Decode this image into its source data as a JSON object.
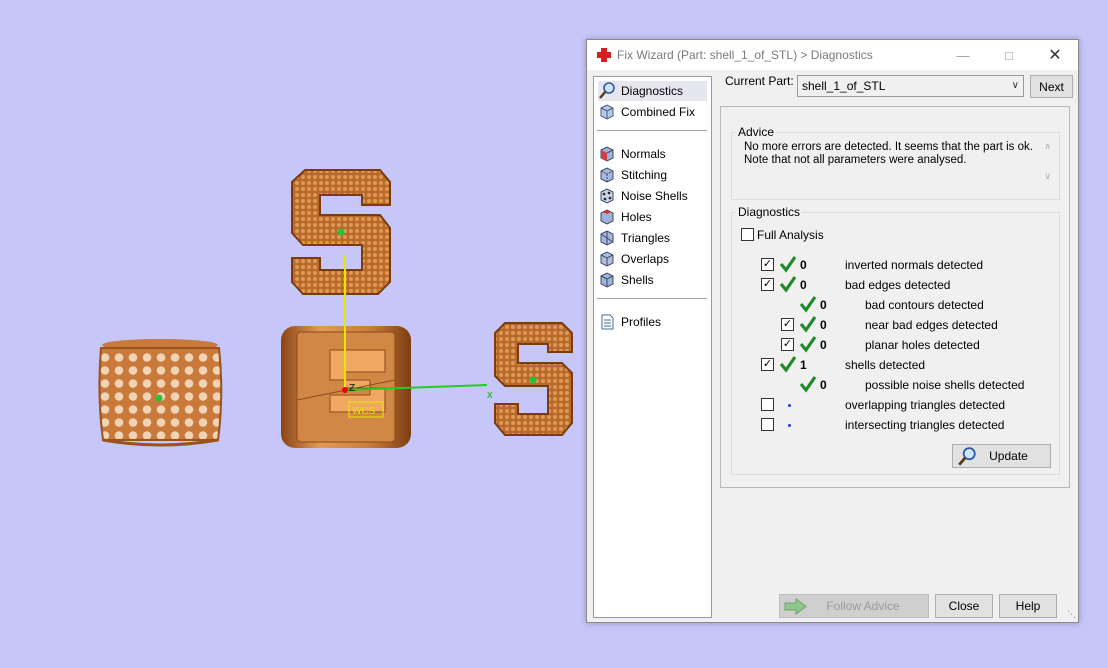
{
  "viewport": {
    "axis_x_label": "x",
    "axis_z_label": "Z",
    "wcs_label": "WCS",
    "colors": {
      "background": "#c6c6f8",
      "part": "#c87a3a",
      "axis_x": "#22cc22",
      "axis_z": "#e6e600"
    }
  },
  "window": {
    "title": "Fix Wizard (Part: shell_1_of_STL) > Diagnostics",
    "minimize_icon": "minimize-icon",
    "maximize_icon": "maximize-icon",
    "close_icon": "close-icon"
  },
  "nav": {
    "items": [
      {
        "label": "Diagnostics",
        "icon": "magnifier-icon",
        "selected": true
      },
      {
        "label": "Combined Fix",
        "icon": "cube-icon"
      },
      {
        "label": "Normals",
        "icon": "normals-cube-icon"
      },
      {
        "label": "Stitching",
        "icon": "stitching-cube-icon"
      },
      {
        "label": "Noise Shells",
        "icon": "noise-shells-icon"
      },
      {
        "label": "Holes",
        "icon": "holes-cube-icon"
      },
      {
        "label": "Triangles",
        "icon": "triangles-cube-icon"
      },
      {
        "label": "Overlaps",
        "icon": "overlaps-cube-icon"
      },
      {
        "label": "Shells",
        "icon": "shells-cube-icon"
      },
      {
        "label": "Profiles",
        "icon": "document-icon"
      }
    ]
  },
  "current_part": {
    "label": "Current Part:",
    "value": "shell_1_of_STL",
    "next_label": "Next"
  },
  "advice": {
    "title": "Advice",
    "line1": "No more errors are detected. It seems that the part is ok.",
    "line2": "Note that not all parameters were analysed."
  },
  "diagnostics": {
    "title": "Diagnostics",
    "full_analysis_label": "Full Analysis",
    "full_analysis_checked": false,
    "rows": [
      {
        "label": "inverted normals detected",
        "count": "0",
        "checkbox": true,
        "checked": true,
        "status": "ok"
      },
      {
        "label": "bad edges detected",
        "count": "0",
        "checkbox": true,
        "checked": true,
        "status": "ok"
      },
      {
        "label": "bad contours detected",
        "count": "0",
        "checkbox": false,
        "status": "ok"
      },
      {
        "label": "near bad edges detected",
        "count": "0",
        "checkbox": true,
        "checked": true,
        "status": "ok"
      },
      {
        "label": "planar holes detected",
        "count": "0",
        "checkbox": true,
        "checked": true,
        "status": "ok"
      },
      {
        "label": "shells detected",
        "count": "1",
        "checkbox": true,
        "checked": true,
        "status": "ok"
      },
      {
        "label": "possible noise shells detected",
        "count": "0",
        "checkbox": false,
        "status": "ok"
      },
      {
        "label": "overlapping triangles detected",
        "count": "",
        "checkbox": true,
        "checked": false,
        "status": "pending"
      },
      {
        "label": "intersecting triangles detected",
        "count": "",
        "checkbox": true,
        "checked": false,
        "status": "pending"
      }
    ],
    "update_label": "Update"
  },
  "footer": {
    "follow_advice_label": "Follow Advice",
    "close_label": "Close",
    "help_label": "Help"
  }
}
